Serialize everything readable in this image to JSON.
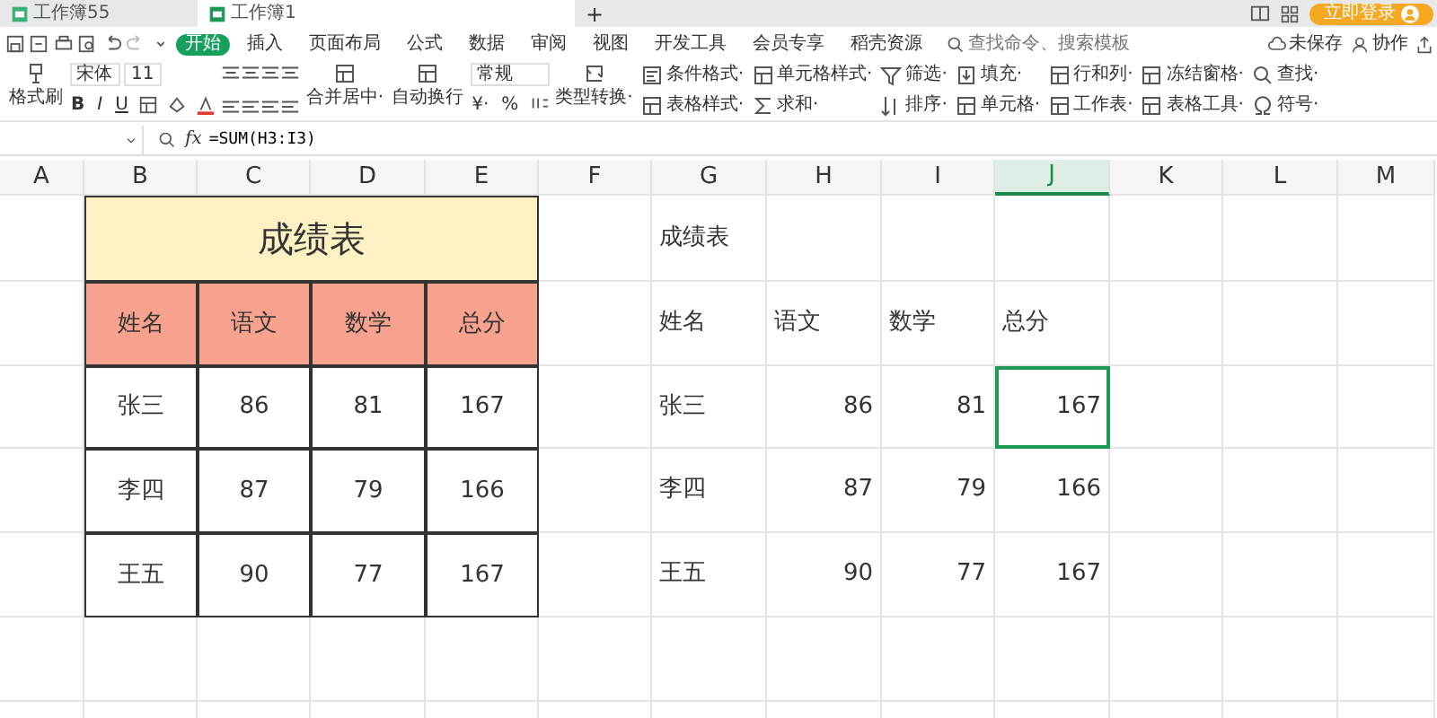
{
  "window_tabs": [
    {
      "label": "工作簿55",
      "selected": false
    },
    {
      "label": "工作簿1",
      "selected": true
    }
  ],
  "new_tab": "+",
  "login_button": "立即登录",
  "menu": [
    {
      "label": "开始",
      "selected": true
    },
    {
      "label": "插入",
      "selected": false
    },
    {
      "label": "页面布局",
      "selected": false
    },
    {
      "label": "公式",
      "selected": false
    },
    {
      "label": "数据",
      "selected": false
    },
    {
      "label": "审阅",
      "selected": false
    },
    {
      "label": "视图",
      "selected": false
    },
    {
      "label": "开发工具",
      "selected": false
    },
    {
      "label": "会员专享",
      "selected": false
    },
    {
      "label": "稻壳资源",
      "selected": false
    }
  ],
  "search": {
    "placeholder": "查找命令、搜索模板"
  },
  "status_links": [
    "未保存",
    "协作"
  ],
  "ribbon": {
    "paste_brush": "格式刷",
    "font": "宋体",
    "font_size": "11",
    "format_buttons": [
      "B",
      "I",
      "U"
    ],
    "merge": "合并居中·",
    "wrap": "自动换行",
    "number_format": "常规",
    "currency": "¥·",
    "percent": "%",
    "convert": "类型转换·",
    "items": [
      "条件格式·",
      "表格样式·",
      "单元格样式·",
      "求和·",
      "筛选·",
      "排序·",
      "填充·",
      "单元格·",
      "行和列·",
      "工作表·",
      "冻结窗格·",
      "表格工具·",
      "查找·",
      "符号·"
    ]
  },
  "formula_bar": {
    "function_label": "fx",
    "formula": "=SUM(H3:I3)"
  },
  "sheet": {
    "columns": [
      {
        "label": "A",
        "selected": false
      },
      {
        "label": "B",
        "selected": false
      },
      {
        "label": "C",
        "selected": false
      },
      {
        "label": "D",
        "selected": false
      },
      {
        "label": "E",
        "selected": false
      },
      {
        "label": "F",
        "selected": false
      },
      {
        "label": "G",
        "selected": false
      },
      {
        "label": "H",
        "selected": false
      },
      {
        "label": "I",
        "selected": false
      },
      {
        "label": "J",
        "selected": true
      },
      {
        "label": "K",
        "selected": false
      },
      {
        "label": "L",
        "selected": false
      },
      {
        "label": "M",
        "selected": false
      }
    ],
    "rows": [
      {
        "cells": [
          "",
          {
            "text": "成绩表",
            "kind": "title",
            "selected": false
          },
          "",
          "",
          "",
          "",
          {
            "text": "成绩表",
            "kind": "text",
            "selected": false
          },
          "",
          "",
          "",
          "",
          "",
          ""
        ]
      },
      {
        "cells": [
          "",
          {
            "text": "姓名",
            "kind": "header",
            "selected": false
          },
          {
            "text": "语文",
            "kind": "header",
            "selected": false
          },
          {
            "text": "数学",
            "kind": "header",
            "selected": false
          },
          {
            "text": "总分",
            "kind": "header",
            "selected": false
          },
          "",
          {
            "text": "姓名",
            "kind": "text",
            "selected": false
          },
          {
            "text": "语文",
            "kind": "text",
            "selected": false
          },
          {
            "text": "数学",
            "kind": "text",
            "selected": false
          },
          {
            "text": "总分",
            "kind": "text",
            "selected": false
          },
          "",
          "",
          ""
        ]
      },
      {
        "cells": [
          "",
          {
            "text": "张三",
            "kind": "boxed",
            "selected": false
          },
          {
            "text": "86",
            "kind": "boxed",
            "selected": false
          },
          {
            "text": "81",
            "kind": "boxed",
            "selected": false
          },
          {
            "text": "167",
            "kind": "boxed",
            "selected": false
          },
          "",
          {
            "text": "张三",
            "kind": "text",
            "selected": false
          },
          {
            "text": "86",
            "kind": "number",
            "selected": false
          },
          {
            "text": "81",
            "kind": "number",
            "selected": false
          },
          {
            "text": "167",
            "kind": "number",
            "selected": true
          },
          "",
          "",
          ""
        ]
      },
      {
        "cells": [
          "",
          {
            "text": "李四",
            "kind": "boxed",
            "selected": false
          },
          {
            "text": "87",
            "kind": "boxed",
            "selected": false
          },
          {
            "text": "79",
            "kind": "boxed",
            "selected": false
          },
          {
            "text": "166",
            "kind": "boxed",
            "selected": false
          },
          "",
          {
            "text": "李四",
            "kind": "text",
            "selected": false
          },
          {
            "text": "87",
            "kind": "number",
            "selected": false
          },
          {
            "text": "79",
            "kind": "number",
            "selected": false
          },
          {
            "text": "166",
            "kind": "number",
            "selected": false
          },
          "",
          "",
          ""
        ]
      },
      {
        "cells": [
          "",
          {
            "text": "王五",
            "kind": "boxed",
            "selected": false
          },
          {
            "text": "90",
            "kind": "boxed",
            "selected": false
          },
          {
            "text": "77",
            "kind": "boxed",
            "selected": false
          },
          {
            "text": "167",
            "kind": "boxed",
            "selected": false
          },
          "",
          {
            "text": "王五",
            "kind": "text",
            "selected": false
          },
          {
            "text": "90",
            "kind": "number",
            "selected": false
          },
          {
            "text": "77",
            "kind": "number",
            "selected": false
          },
          {
            "text": "167",
            "kind": "number",
            "selected": false
          },
          "",
          "",
          ""
        ]
      },
      {
        "cells": [
          "",
          "",
          "",
          "",
          "",
          "",
          "",
          "",
          "",
          "",
          "",
          "",
          ""
        ]
      },
      {
        "cells": [
          "",
          "",
          "",
          "",
          "",
          "",
          "",
          "",
          "",
          "",
          "",
          "",
          ""
        ]
      }
    ]
  }
}
